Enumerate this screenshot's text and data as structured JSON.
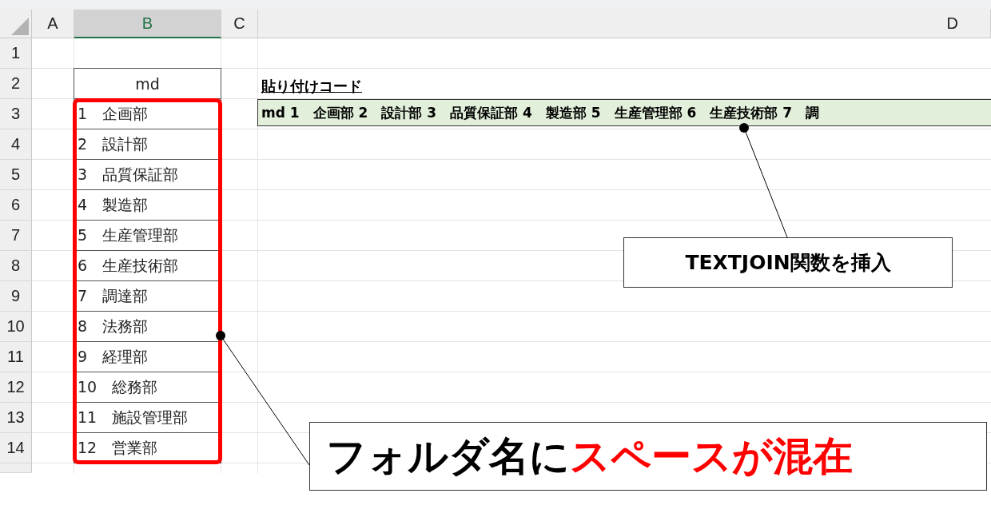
{
  "columns": [
    {
      "label": "A",
      "selected": false
    },
    {
      "label": "B",
      "selected": true
    },
    {
      "label": "C",
      "selected": false
    },
    {
      "label": "D",
      "selected": false
    }
  ],
  "rows": [
    {
      "number": "1"
    },
    {
      "number": "2",
      "b": {
        "text": "md",
        "kind": "header"
      },
      "d": {
        "text": "貼り付けコード",
        "kind": "title"
      }
    },
    {
      "number": "3",
      "b": {
        "text": "1　企画部",
        "kind": "item"
      },
      "d": {
        "text": "md 1　企画部 2　設計部 3　品質保証部 4　製造部 5　生産管理部 6　生産技術部 7　調",
        "kind": "result"
      }
    },
    {
      "number": "4",
      "b": {
        "text": "2　設計部",
        "kind": "item"
      }
    },
    {
      "number": "5",
      "b": {
        "text": "3　品質保証部",
        "kind": "item"
      }
    },
    {
      "number": "6",
      "b": {
        "text": "4　製造部",
        "kind": "item"
      }
    },
    {
      "number": "7",
      "b": {
        "text": "5　生産管理部",
        "kind": "item"
      }
    },
    {
      "number": "8",
      "b": {
        "text": "6　生産技術部",
        "kind": "item"
      }
    },
    {
      "number": "9",
      "b": {
        "text": "7　調達部",
        "kind": "item"
      }
    },
    {
      "number": "10",
      "b": {
        "text": "8　法務部",
        "kind": "item"
      }
    },
    {
      "number": "11",
      "b": {
        "text": "9　経理部",
        "kind": "item"
      }
    },
    {
      "number": "12",
      "b": {
        "text": "10　総務部",
        "kind": "item"
      }
    },
    {
      "number": "13",
      "b": {
        "text": "11　施設管理部",
        "kind": "item"
      }
    },
    {
      "number": "14",
      "b": {
        "text": "12　営業部",
        "kind": "item"
      }
    },
    {}
  ],
  "callouts": [
    {
      "parts": [
        {
          "text": "TEXTJOIN関数を挿入",
          "color": "#000000"
        }
      ]
    },
    {
      "parts": [
        {
          "text": "フォルダ名に",
          "color": "#000000"
        },
        {
          "text": "スペースが混在",
          "color": "#ff0000"
        }
      ]
    }
  ]
}
